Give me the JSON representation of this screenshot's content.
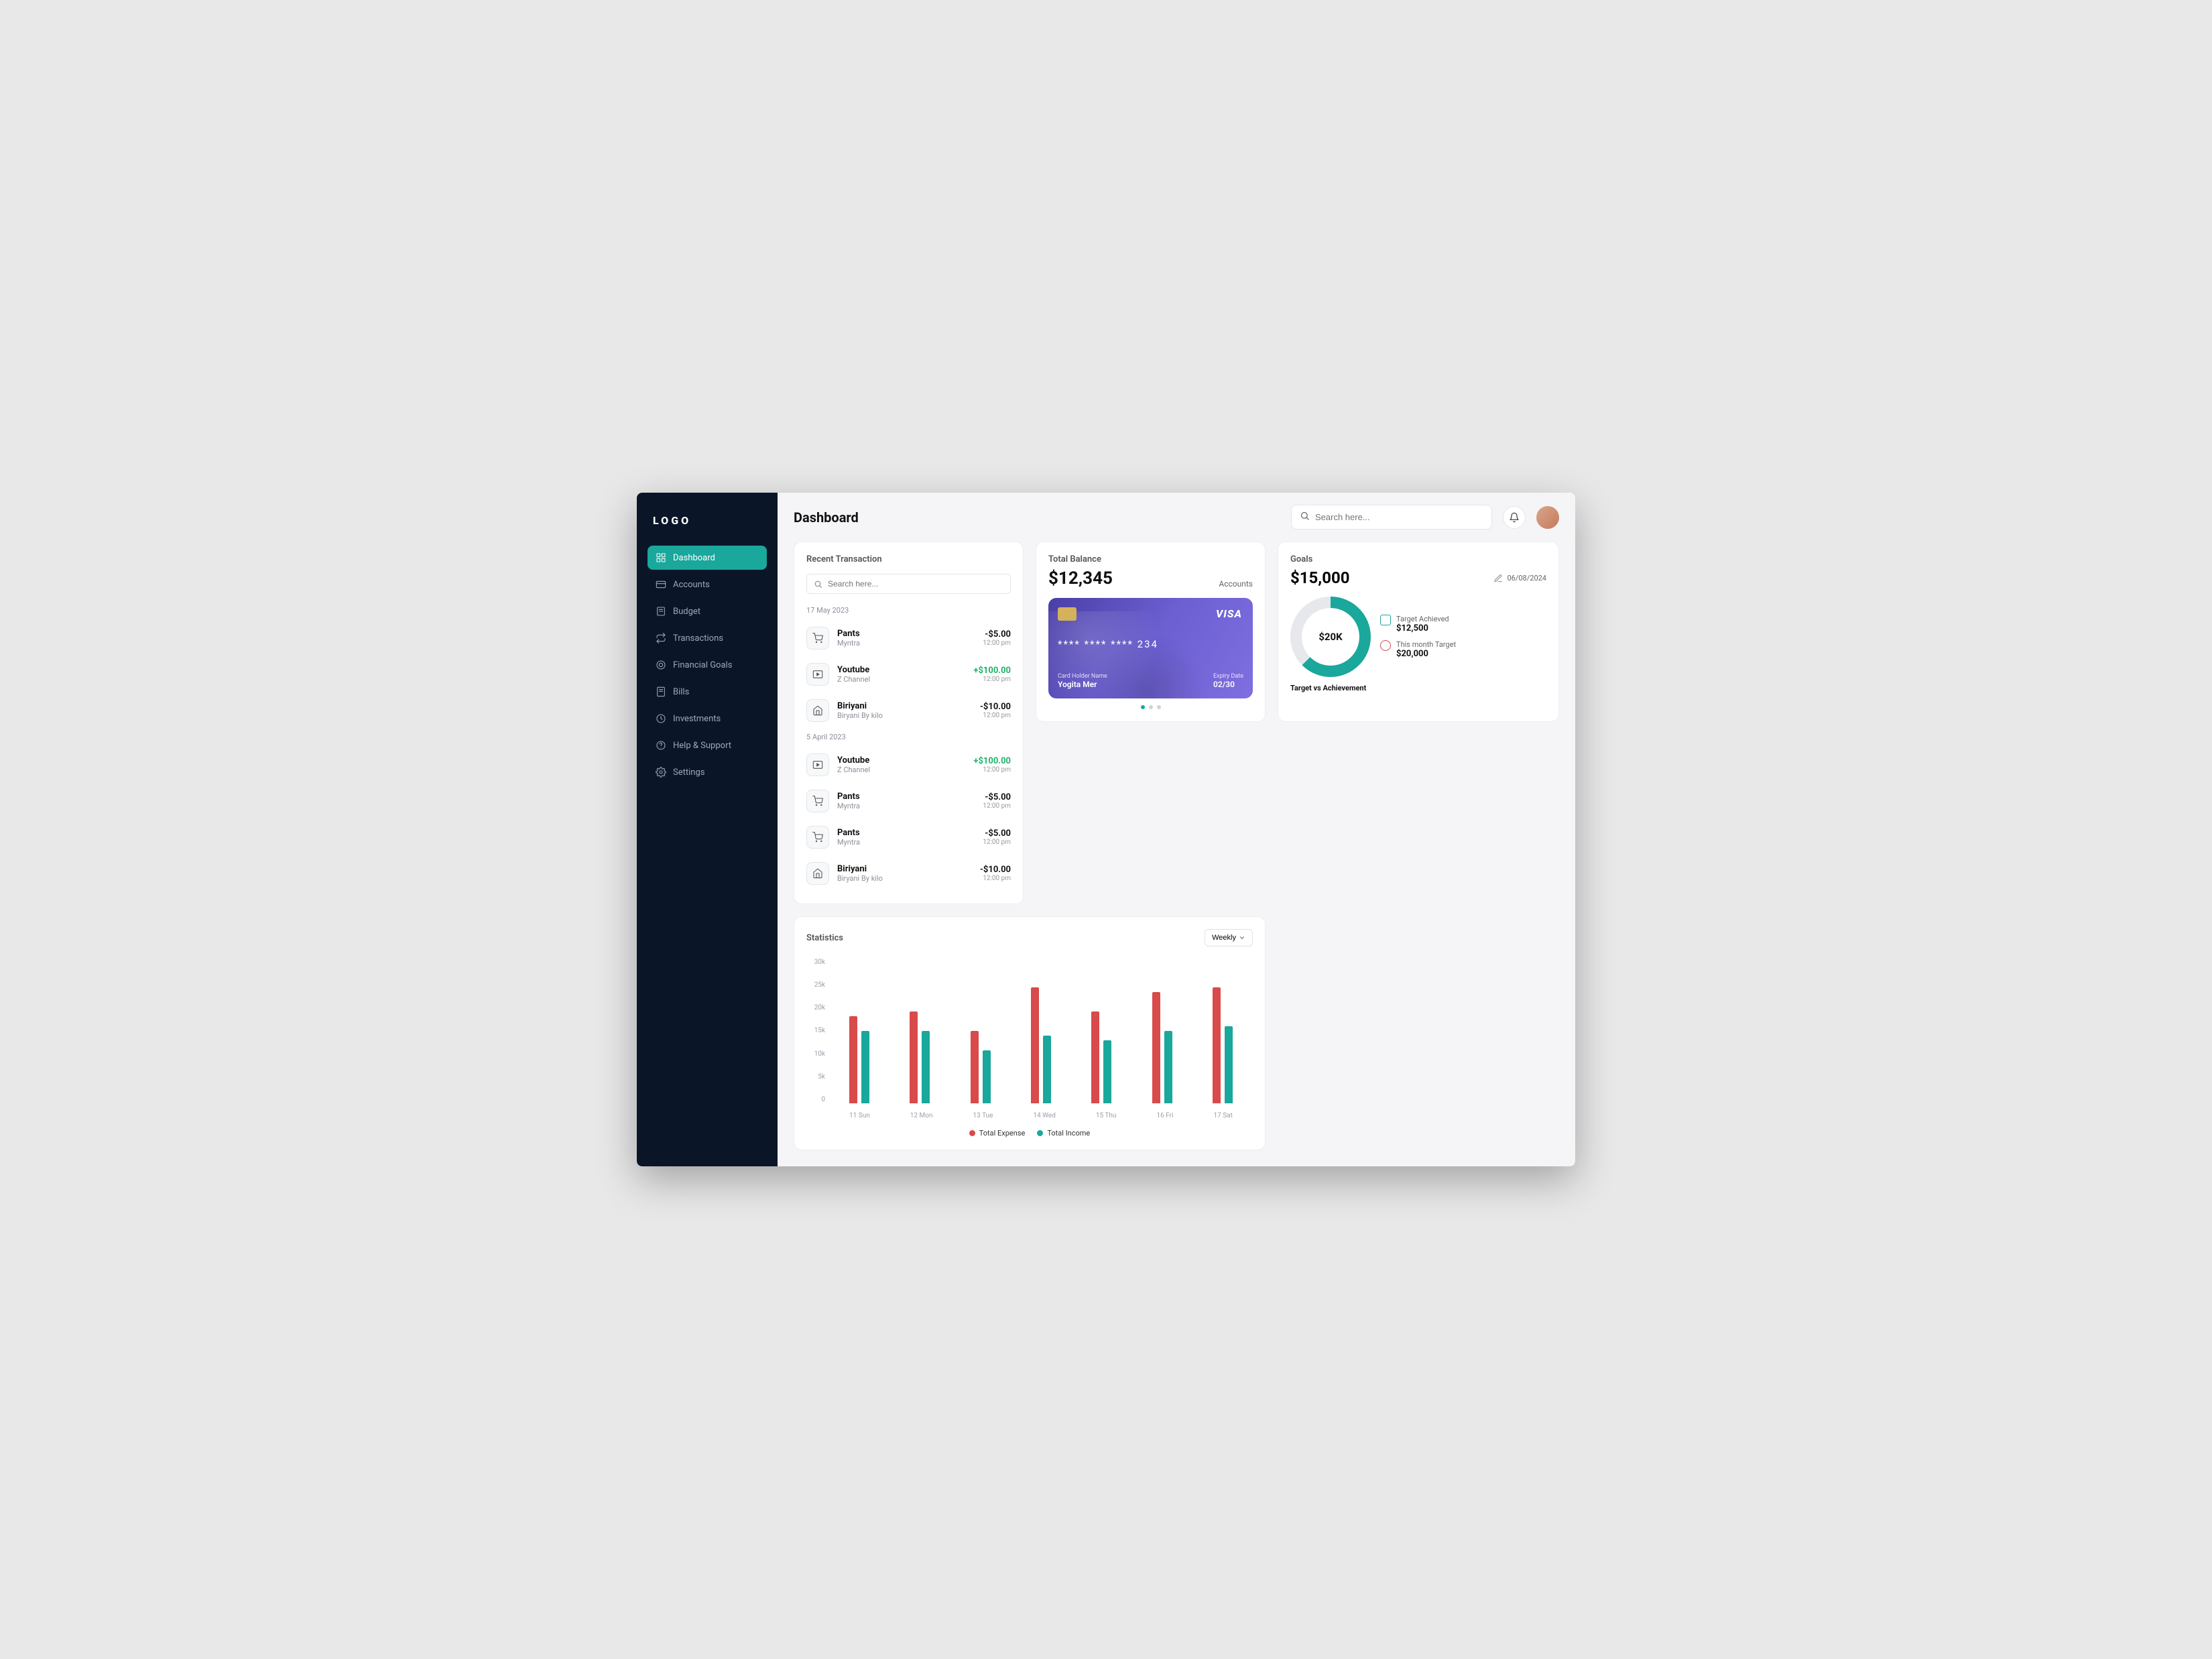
{
  "logo": "LOGO",
  "page_title": "Dashboard",
  "search_placeholder": "Search here...",
  "sidebar": {
    "items": [
      {
        "label": "Dashboard",
        "icon": "grid-icon",
        "active": true
      },
      {
        "label": "Accounts",
        "icon": "card-icon"
      },
      {
        "label": "Budget",
        "icon": "budget-icon"
      },
      {
        "label": "Transactions",
        "icon": "transfer-icon"
      },
      {
        "label": "Financial Goals",
        "icon": "goal-icon"
      },
      {
        "label": "Bills",
        "icon": "bill-icon"
      },
      {
        "label": "Investments",
        "icon": "invest-icon"
      },
      {
        "label": "Help & Support",
        "icon": "help-icon"
      },
      {
        "label": "Settings",
        "icon": "settings-icon"
      }
    ]
  },
  "balance": {
    "title": "Total Balance",
    "amount": "$12,345",
    "accounts_label": "Accounts",
    "card": {
      "brand": "VISA",
      "number": "**** **** **** 234",
      "holder_label": "Card Holder Name",
      "holder": "Yogita Mer",
      "expiry_label": "Expiry Date",
      "expiry": "02/30"
    }
  },
  "goals": {
    "title": "Goals",
    "amount": "$15,000",
    "date": "06/08/2024",
    "pencil_icon": "pencil-icon",
    "ring_label": "$20K",
    "achieved_label": "Target Achieved",
    "achieved_value": "$12,500",
    "month_target_label": "This month Target",
    "month_target_value": "$20,000",
    "footer": "Target vs Achievement"
  },
  "stats": {
    "title": "Statistics",
    "period": "Weekly",
    "y_ticks": [
      "30k",
      "25k",
      "20k",
      "15k",
      "10k",
      "5k",
      "0"
    ],
    "legend_expense": "Total Expense",
    "legend_income": "Total Income"
  },
  "chart_data": {
    "type": "bar",
    "categories": [
      "11 Sun",
      "12 Mon",
      "13 Tue",
      "14 Wed",
      "15 Thu",
      "16 Fri",
      "17 Sat"
    ],
    "series": [
      {
        "name": "Total Expense",
        "values": [
          18000,
          19000,
          15000,
          24000,
          19000,
          23000,
          24000
        ]
      },
      {
        "name": "Total Income",
        "values": [
          15000,
          15000,
          11000,
          14000,
          13000,
          15000,
          16000
        ]
      }
    ],
    "ylim": [
      0,
      30000
    ],
    "ylabel": "",
    "xlabel": ""
  },
  "transactions": {
    "title": "Recent Transaction",
    "search_placeholder": "Search here...",
    "groups": [
      {
        "date": "17 May 2023",
        "items": [
          {
            "icon": "cart-icon",
            "name": "Pants",
            "sub": "Myntra",
            "amount": "-$5.00",
            "time": "12:00 pm",
            "sign": "neg"
          },
          {
            "icon": "video-icon",
            "name": "Youtube",
            "sub": "Z Channel",
            "amount": "+$100.00",
            "time": "12:00 pm",
            "sign": "pos"
          },
          {
            "icon": "home-icon",
            "name": "Biriyani",
            "sub": "Biryani By kilo",
            "amount": "-$10.00",
            "time": "12:00 pm",
            "sign": "neg"
          }
        ]
      },
      {
        "date": "5 April 2023",
        "items": [
          {
            "icon": "video-icon",
            "name": "Youtube",
            "sub": "Z Channel",
            "amount": "+$100.00",
            "time": "12:00 pm",
            "sign": "pos"
          },
          {
            "icon": "cart-icon",
            "name": "Pants",
            "sub": "Myntra",
            "amount": "-$5.00",
            "time": "12:00 pm",
            "sign": "neg"
          },
          {
            "icon": "cart-icon",
            "name": "Pants",
            "sub": "Myntra",
            "amount": "-$5.00",
            "time": "12:00 pm",
            "sign": "neg"
          },
          {
            "icon": "home-icon",
            "name": "Biriyani",
            "sub": "Biryani By kilo",
            "amount": "-$10.00",
            "time": "12:00 pm",
            "sign": "neg"
          }
        ]
      }
    ]
  }
}
